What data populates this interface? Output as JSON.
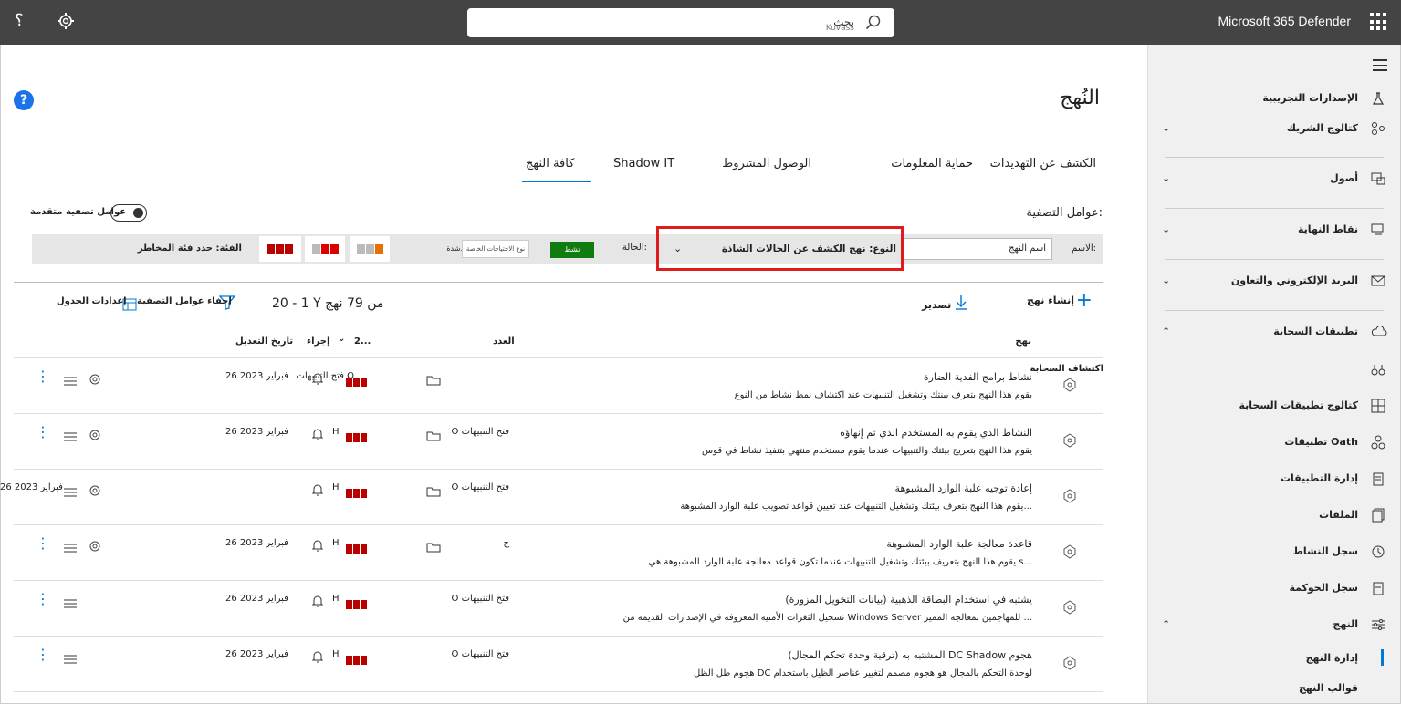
{
  "topbar": {
    "app_name": "Microsoft 365 Defender",
    "search_text": "بحث",
    "search_ghost": "Kovass",
    "help_glyph": "؟"
  },
  "nav": {
    "items": [
      {
        "label": "الإصدارات التجريبية",
        "icon": "flask-icon"
      },
      {
        "label": "كتالوج الشريك",
        "icon": "partner-icon"
      },
      {
        "label": "أصول",
        "icon": "assets-icon"
      },
      {
        "label": "نقاط النهاية",
        "icon": "endpoints-icon"
      },
      {
        "label": "البريد الإلكتروني والتعاون",
        "icon": "mail-icon"
      },
      {
        "label": "تطبيقات السحابة",
        "icon": "cloud-icon"
      }
    ],
    "cloud_sub": [
      {
        "label": "",
        "icon": "binoculars-icon"
      },
      {
        "label": "كتالوج تطبيقات السحابة",
        "icon": "grid-icon"
      },
      {
        "label": "تطبيقات Oath",
        "icon": "apps-icon"
      },
      {
        "label": "إدارة التطبيقات",
        "icon": "clipboard-icon"
      },
      {
        "label": "الملفات",
        "icon": "files-icon"
      },
      {
        "label": "سجل النشاط",
        "icon": "activity-icon"
      },
      {
        "label": "سجل الحوكمة",
        "icon": "governance-icon"
      }
    ],
    "policies": {
      "label": "النهج",
      "icon": "policies-icon"
    },
    "policy_mgmt": "إدارة النهج",
    "policy_templates": "قوالب النهج"
  },
  "page": {
    "title": "النُهج",
    "help": "?"
  },
  "tabs": [
    "الكشف عن التهديدات",
    "حماية المعلومات",
    "الوصول المشروط",
    "Shadow IT",
    "كافة النهج"
  ],
  "filters": {
    "label": "عوامل التصفية:",
    "advanced": "عوامل تصفية متقدمة",
    "name_label": "الاسم:",
    "name_value": "اسم النهج",
    "type_value": "النوع: نهج الكشف عن الحالات الشاذة",
    "status_label": "الحالة:",
    "status_value": "نشط",
    "alert_type": "نوع الاحتياجات الخاصة",
    "extra": "شدة.",
    "category": "الفئة: حدد فئة المخاطر"
  },
  "toolbar": {
    "create": "إنشاء نهج",
    "export": "تصدير",
    "count": "20 - 1 Y من 79 نهج",
    "hide_filters": "إخفاء عوامل التصفية",
    "table_settings": "إعدادات الجدول"
  },
  "table": {
    "headers": {
      "policy": "نهج",
      "count": "العدد",
      "severity": "2...",
      "action": "إجراء",
      "modified": "تاريخ التعديل"
    },
    "section": "اكتشاف السحابة",
    "rows": [
      {
        "name": "نشاط برامج الفدية الضارة",
        "desc": "يقوم هذا النهج بتعرف بينتك وتشغيل التنبيهات عند اكتشاف نمط نشاط من النوع",
        "count": "فتح التنبيهات O",
        "date": "26 فبراير 2023"
      },
      {
        "name": "النشاط الذي يقوم به المستخدم الذي تم إنهاؤه",
        "desc": "يقوم هذا النهج بتعريج بيئتك والتنبيهات عندما يقوم مستخدم منتهي بتنفيذ نشاط في قوس",
        "count": "O فتح التنبيهات",
        "date": "26 فبراير 2023"
      },
      {
        "name": "إعادة توجيه علبة الوارد المشبوهة",
        "desc": "يقوم هذا النهج بتعرف بيئتك وتشغيل التنبيهات عند تعيين قواعد تصويب علبة الوارد المشبوهة...",
        "count": "O فتح التنبيهات",
        "date": "26 فبراير 2023"
      },
      {
        "name": "قاعدة معالجة علبة الوارد المشبوهة",
        "desc": "يقوم هذا النهج بتعريف بيئتك وتشغيل التنبيهات عندما تكون قواعد معالجة علبة الوارد المشبوهة هي s...",
        "count": "ج",
        "date": "26 فبراير 2023"
      },
      {
        "name": "(يشتبه في استخدام البطاقة الذهبية (بيانات التخويل المزورة",
        "desc": "تسجيل الثغرات الأمنية المعروفة في الإصدارات القديمة من Windows Server للمهاجمين بمعالجة المميز ...",
        "count": "O فتح التنبيهات",
        "date": "26 فبراير 2023"
      },
      {
        "name": "(المشتبه به (ترقية وحدة تحكم المجال DC Shadow هجوم",
        "desc": "هجوم ظل الظل DC لوحدة التحكم بالمجال هو هجوم مصمم لتغيير عناصر الظيل باستخدام",
        "count": "O فتح التنبيهات",
        "date": "26 فبراير 2023"
      }
    ]
  },
  "colors": {
    "accent": "#0078d4",
    "highlight": "#e01b1b",
    "severity": "#b00000",
    "status": "#107c10"
  }
}
